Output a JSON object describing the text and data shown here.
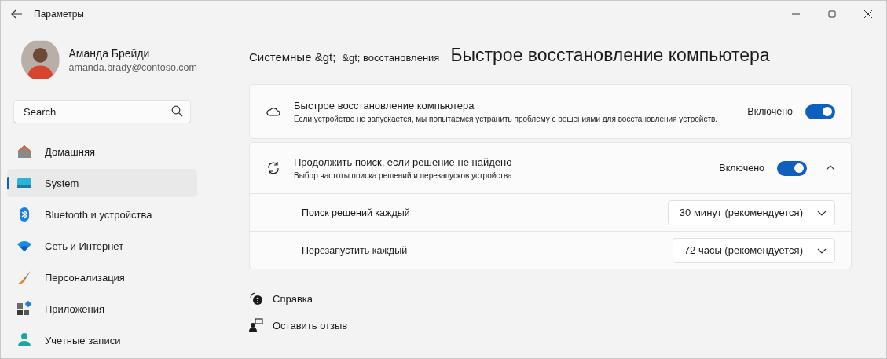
{
  "window": {
    "title": "Параметры"
  },
  "user": {
    "name": "Аманда Брейди",
    "email": "amanda.brady@contoso.com"
  },
  "search": {
    "placeholder": "Search"
  },
  "sidebar": {
    "items": [
      {
        "label": "Домашняя",
        "selected": false
      },
      {
        "label": "System",
        "selected": true
      },
      {
        "label": "Bluetooth и устройства",
        "selected": false
      },
      {
        "label": "Сеть и Интернет",
        "selected": false
      },
      {
        "label": "Персонализация",
        "selected": false
      },
      {
        "label": "Приложения",
        "selected": false
      },
      {
        "label": "Учетные записи",
        "selected": false
      }
    ]
  },
  "breadcrumb": [
    "Системные &gt;",
    "&gt; восстановления"
  ],
  "page_title": "Быстрое восстановление компьютера",
  "cards": [
    {
      "title": "Быстрое восстановление компьютера",
      "description": "Если устройство не запускается, мы попытаемся устранить проблему с решениями для восстановления устройств.",
      "toggle_label": "Включено",
      "on": true
    },
    {
      "title": "Продолжить поиск, если решение не найдено",
      "description": "Выбор частоты поиска решений и перезапусков устройства",
      "toggle_label": "Включено",
      "on": true,
      "expanded": true,
      "settings": [
        {
          "label": "Поиск решений каждый",
          "value": "30 минут (рекомендуется)"
        },
        {
          "label": "Перезапустить каждый",
          "value": "72 часы (рекомендуется)"
        }
      ]
    }
  ],
  "links": [
    {
      "label": "Справка"
    },
    {
      "label": "Оставить отзыв"
    }
  ]
}
